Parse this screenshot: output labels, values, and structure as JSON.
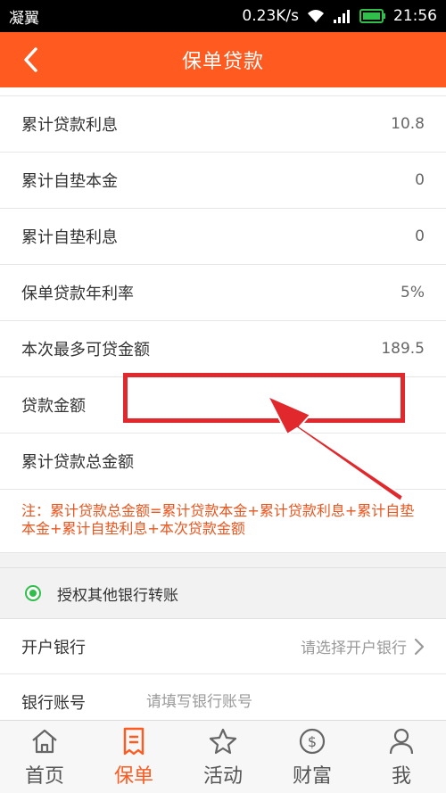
{
  "status_bar": {
    "carrier": "凝翼",
    "speed": "0.23K/s",
    "time": "21:56"
  },
  "nav": {
    "title": "保单贷款"
  },
  "loan_rows": [
    {
      "label": "累计贷款利息",
      "value": "10.8"
    },
    {
      "label": "累计自垫本金",
      "value": "0"
    },
    {
      "label": "累计自垫利息",
      "value": "0"
    },
    {
      "label": "保单贷款年利率",
      "value": "5%"
    },
    {
      "label": "本次最多可贷金额",
      "value": "189.5"
    }
  ],
  "loan_amount": {
    "label": "贷款金额",
    "value": ""
  },
  "total_amount": {
    "label": "累计贷款总金额",
    "value": ""
  },
  "note": "注：累计贷款总金额=累计贷款本金+累计贷款利息+累计自垫本金+累计自垫利息+本次贷款金额",
  "auth": {
    "label": "授权其他银行转账"
  },
  "bank": {
    "label": "开户银行",
    "placeholder": "请选择开户银行"
  },
  "account": {
    "label": "银行账号",
    "placeholder": "请填写银行账号"
  },
  "tabs": [
    {
      "label": "首页",
      "icon": "home-icon"
    },
    {
      "label": "保单",
      "icon": "policy-icon"
    },
    {
      "label": "活动",
      "icon": "star-icon"
    },
    {
      "label": "财富",
      "icon": "wealth-icon"
    },
    {
      "label": "我",
      "icon": "user-icon"
    }
  ],
  "colors": {
    "accent": "#ff5a1f",
    "highlight": "#e0282d",
    "note": "#e8561f",
    "radio": "#2fbf4a"
  }
}
